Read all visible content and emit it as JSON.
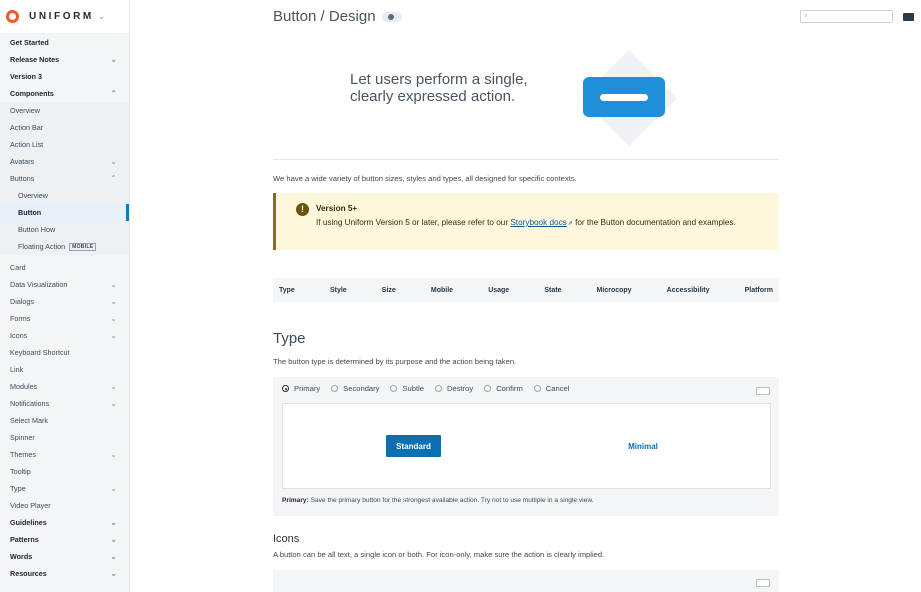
{
  "brand": {
    "name": "UNIFORM"
  },
  "sidebar": {
    "items": [
      {
        "label": "Get Started",
        "bold": true,
        "chevron": ""
      },
      {
        "label": "Release Notes",
        "bold": true,
        "chevron": "down"
      },
      {
        "label": "Version 3",
        "bold": true,
        "chevron": ""
      },
      {
        "label": "Components",
        "bold": true,
        "chevron": "up"
      },
      {
        "label": "Overview",
        "chevron": ""
      },
      {
        "label": "Action Bar",
        "chevron": ""
      },
      {
        "label": "Action List",
        "chevron": ""
      },
      {
        "label": "Avatars",
        "chevron": "down"
      },
      {
        "label": "Buttons",
        "chevron": "up"
      },
      {
        "label": "Overview",
        "sub": true,
        "chevron": ""
      },
      {
        "label": "Button",
        "sub": true,
        "active": true,
        "chevron": ""
      },
      {
        "label": "Button How",
        "sub": true,
        "chevron": ""
      },
      {
        "label": "Floating Action",
        "sub": true,
        "tag": "MOBILE",
        "chevron": ""
      },
      {
        "label": "Card",
        "chevron": "",
        "gap": true
      },
      {
        "label": "Data Visualization",
        "chevron": "down"
      },
      {
        "label": "Dialogs",
        "chevron": "down"
      },
      {
        "label": "Forms",
        "chevron": "down"
      },
      {
        "label": "Icons",
        "chevron": "down"
      },
      {
        "label": "Keyboard Shortcut",
        "chevron": ""
      },
      {
        "label": "Link",
        "chevron": ""
      },
      {
        "label": "Modules",
        "chevron": "down"
      },
      {
        "label": "Notifications",
        "chevron": "down"
      },
      {
        "label": "Select Mark",
        "chevron": ""
      },
      {
        "label": "Spinner",
        "chevron": ""
      },
      {
        "label": "Themes",
        "chevron": "down"
      },
      {
        "label": "Tooltip",
        "chevron": ""
      },
      {
        "label": "Type",
        "chevron": "down"
      },
      {
        "label": "Video Player",
        "chevron": ""
      },
      {
        "label": "Guidelines",
        "bold": true,
        "chevron": "down"
      },
      {
        "label": "Patterns",
        "bold": true,
        "chevron": "down"
      },
      {
        "label": "Words",
        "bold": true,
        "chevron": "down"
      },
      {
        "label": "Resources",
        "bold": true,
        "chevron": "down"
      }
    ]
  },
  "header": {
    "title": "Button / Design"
  },
  "hero": {
    "text": "Let users perform a single, clearly expressed action."
  },
  "intro": "We have a wide variety of button sizes, styles and types, all designed for specific contexts.",
  "notice": {
    "title": "Version 5+",
    "body_before": "If using Uniform Version 5 or later, please refer to our ",
    "link": "Storybook docs",
    "body_after": " for the Button documentation and examples."
  },
  "table_tabs": [
    "Type",
    "Style",
    "Size",
    "Mobile",
    "Usage",
    "State",
    "Microcopy",
    "Accessibility",
    "Platform"
  ],
  "type_section": {
    "heading": "Type",
    "description": "The button type is determined by its purpose and the action being taken.",
    "options": [
      "Primary",
      "Secondary",
      "Subtle",
      "Destroy",
      "Confirm",
      "Cancel"
    ],
    "selected": "Primary",
    "standard_label": "Standard",
    "minimal_label": "Minimal",
    "caption_label": "Primary:",
    "caption_text": " Save the primary button for the strongest available action. Try not to use multiple in a single view."
  },
  "icons_section": {
    "heading": "Icons",
    "description": "A button can be all text, a single icon or both. For icon-only, make sure the action is clearly implied."
  },
  "colors": {
    "accent": "#0d6fb3",
    "brand": "#f15a22",
    "notice_bg": "#fdf7dc"
  }
}
